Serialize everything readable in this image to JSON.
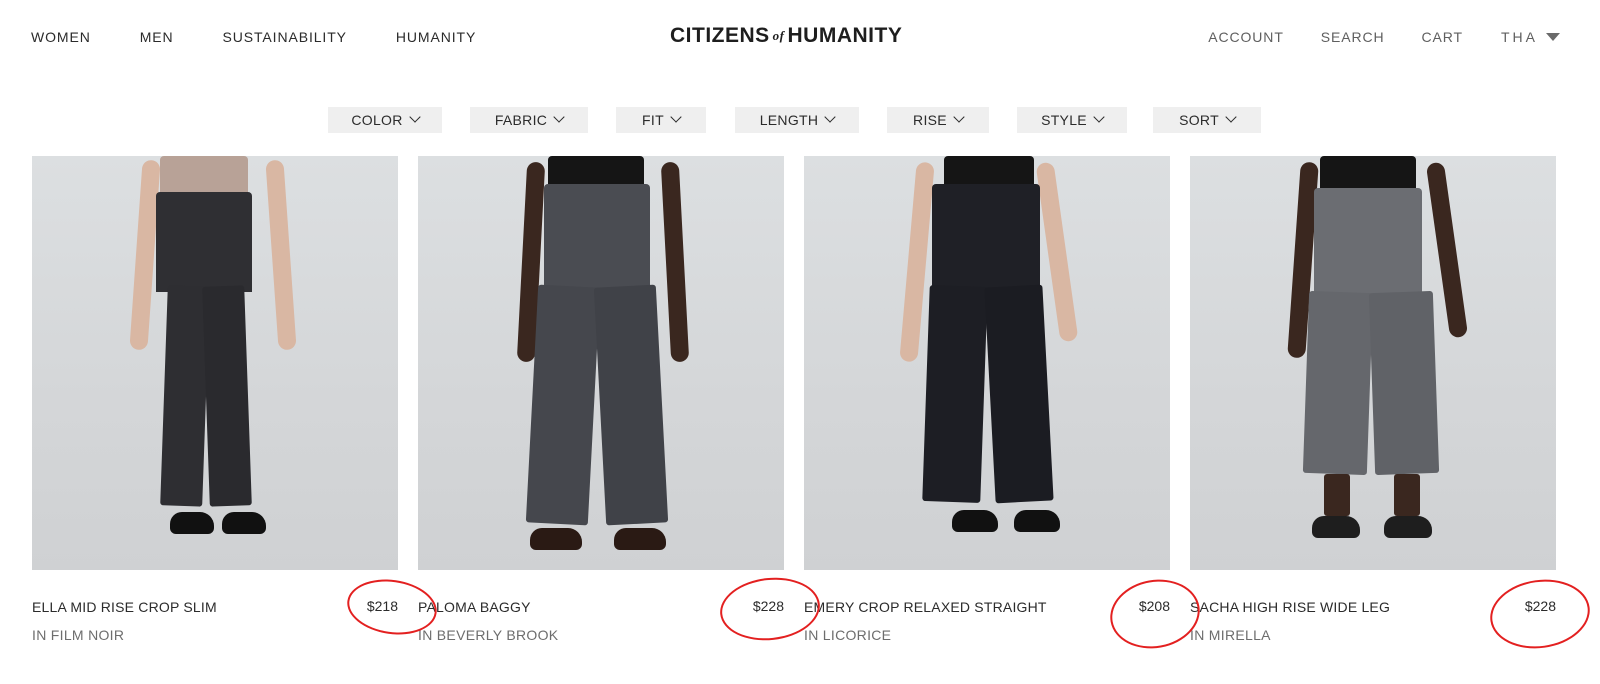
{
  "header": {
    "nav_left": [
      "WOMEN",
      "MEN",
      "SUSTAINABILITY",
      "HUMANITY"
    ],
    "logo": {
      "part1": "CITIZENS",
      "part2": "of",
      "part3": "HUMANITY"
    },
    "nav_right": [
      "ACCOUNT",
      "SEARCH",
      "CART"
    ],
    "region": "THA"
  },
  "filters": [
    "COLOR",
    "FABRIC",
    "FIT",
    "LENGTH",
    "RISE",
    "STYLE",
    "SORT"
  ],
  "products": [
    {
      "name": "ELLA MID RISE CROP SLIM",
      "color": "IN FILM NOIR",
      "price": "$218"
    },
    {
      "name": "PALOMA BAGGY",
      "color": "IN BEVERLY BROOK",
      "price": "$228"
    },
    {
      "name": "EMERY CROP RELAXED STRAIGHT",
      "color": "IN LICORICE",
      "price": "$208"
    },
    {
      "name": "SACHA HIGH RISE WIDE LEG",
      "color": "IN MIRELLA",
      "price": "$228"
    }
  ],
  "colors": {
    "annotation": "#e32020",
    "filter_bg": "#efefef",
    "photo_bg": "#d8dadc"
  }
}
